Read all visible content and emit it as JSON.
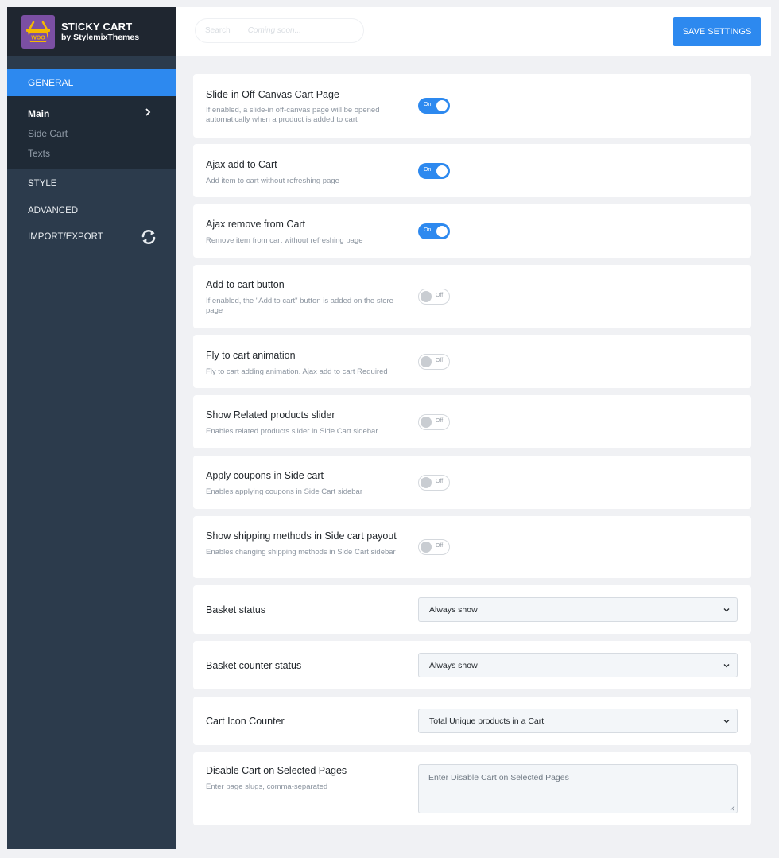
{
  "brand": {
    "title": "STICKY CART",
    "subtitle": "by StylemixThemes",
    "logo_text": "WOO",
    "logo_color": "#7b4fa3"
  },
  "sidebar": {
    "general": "GENERAL",
    "subitems": [
      {
        "label": "Main",
        "active": true
      },
      {
        "label": "Side Cart",
        "active": false
      },
      {
        "label": "Texts",
        "active": false
      }
    ],
    "style": "STYLE",
    "advanced": "ADVANCED",
    "import_export": "IMPORT/EXPORT"
  },
  "header": {
    "search_label": "Search",
    "search_placeholder": "Coming soon...",
    "save_label": "SAVE SETTINGS",
    "accent": "#2d89ef"
  },
  "settings": [
    {
      "title": "Slide-in Off-Canvas Cart Page",
      "desc": "If enabled, a slide-in off-canvas page will be opened automatically when a product is added to cart",
      "state": "On"
    },
    {
      "title": "Ajax add to Cart",
      "desc": "Add item to cart without refreshing page",
      "state": "On"
    },
    {
      "title": "Ajax remove from Cart",
      "desc": "Remove item from cart without refreshing page",
      "state": "On"
    },
    {
      "title": "Add to cart button",
      "desc": "If enabled, the \"Add to cart\" button is added on the store page",
      "state": "Off"
    },
    {
      "title": "Fly to cart animation",
      "desc": "Fly to cart adding animation. Ajax add to cart Required",
      "state": "Off"
    },
    {
      "title": "Show Related products slider",
      "desc": "Enables related products slider in Side Cart sidebar",
      "state": "Off"
    },
    {
      "title": "Apply coupons in Side cart",
      "desc": "Enables applying coupons in Side Cart sidebar",
      "state": "Off"
    },
    {
      "title": "Show shipping methods in Side cart payout",
      "desc": "Enables changing shipping methods in Side Cart sidebar",
      "state": "Off"
    }
  ],
  "selects": [
    {
      "title": "Basket status",
      "value": "Always show"
    },
    {
      "title": "Basket counter status",
      "value": "Always show"
    },
    {
      "title": "Cart Icon Counter",
      "value": "Total Unique products in a Cart"
    }
  ],
  "disable_pages": {
    "title": "Disable Cart on Selected Pages",
    "desc": "Enter page slugs, comma-separated",
    "placeholder": "Enter Disable Cart on Selected Pages"
  }
}
